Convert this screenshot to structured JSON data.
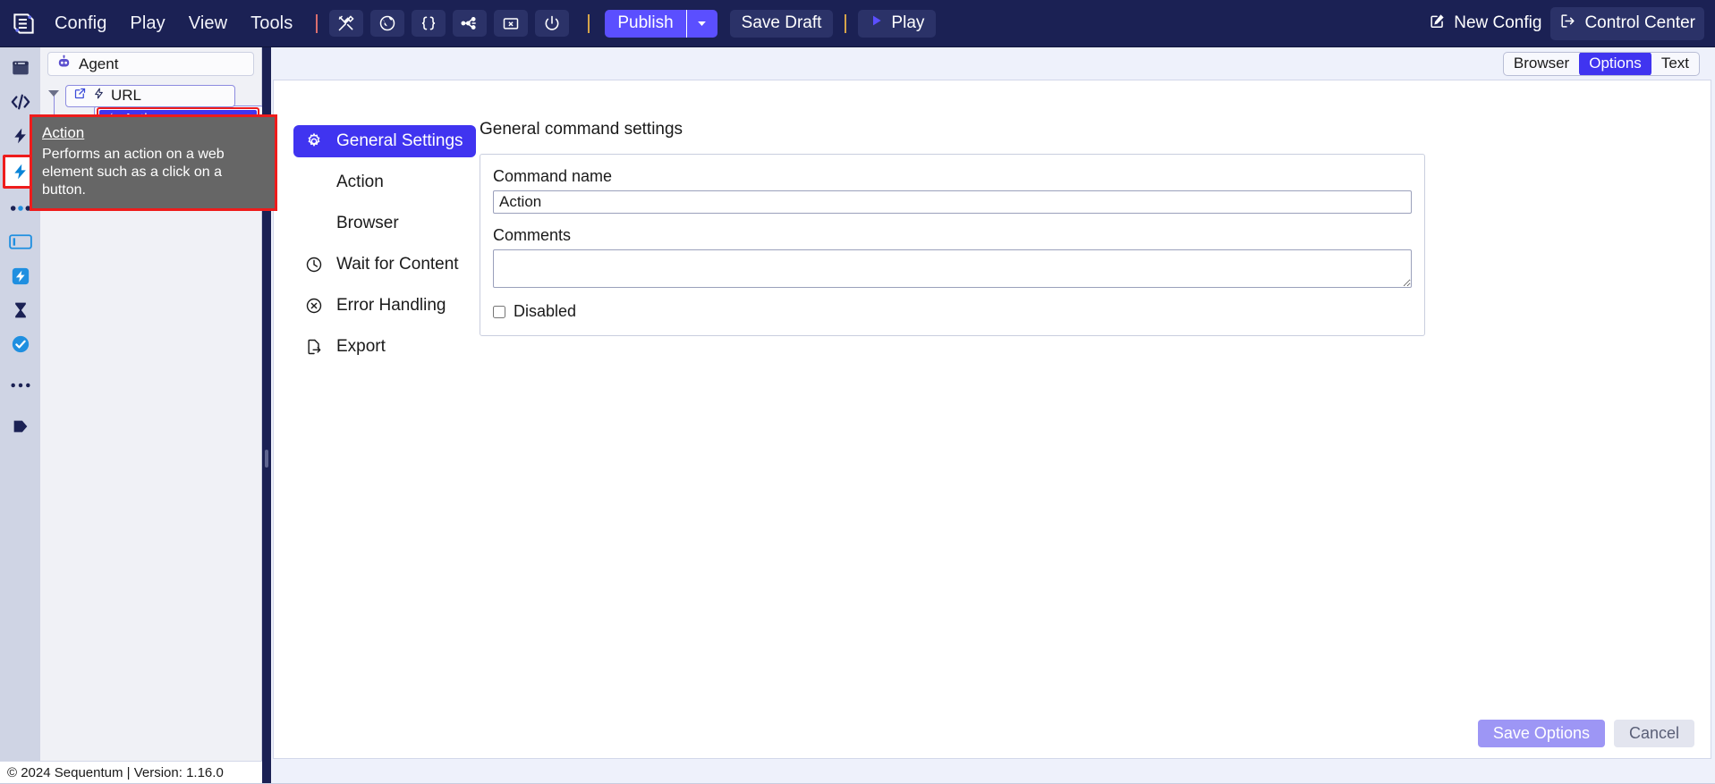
{
  "topbar": {
    "logo": "sequentum-logo-icon",
    "menus": [
      {
        "label": "Config",
        "name": "menu-config"
      },
      {
        "label": "Play",
        "name": "menu-play"
      },
      {
        "label": "View",
        "name": "menu-view"
      },
      {
        "label": "Tools",
        "name": "menu-tools"
      }
    ],
    "tool_icons": [
      {
        "name": "tools-icon",
        "title": "Tools"
      },
      {
        "name": "globe-icon",
        "title": "Browser"
      },
      {
        "name": "code-braces-icon",
        "title": "Script"
      },
      {
        "name": "network-graph-icon",
        "title": "Graph"
      },
      {
        "name": "folder-delete-icon",
        "title": "Clear cache"
      },
      {
        "name": "power-icon",
        "title": "Power"
      }
    ],
    "publish_label": "Publish",
    "publish_caret": "chevron-down-icon",
    "save_draft_label": "Save Draft",
    "play_label": "Play",
    "new_config_label": "New Config",
    "control_center_label": "Control Center",
    "accent_color": "#5b4fff",
    "bar_color": "#1b2154"
  },
  "rail": {
    "items": [
      {
        "name": "rail-browser-icon",
        "selected": false
      },
      {
        "name": "rail-code-icon",
        "selected": false
      },
      {
        "name": "rail-action-dark-icon",
        "selected": false
      },
      {
        "name": "rail-action-blue-icon",
        "selected": true
      },
      {
        "name": "rail-dots-icon",
        "selected": false
      },
      {
        "name": "rail-input-icon",
        "selected": false
      },
      {
        "name": "rail-action-square-icon",
        "selected": false
      },
      {
        "name": "rail-hourglass-icon",
        "selected": false
      },
      {
        "name": "rail-check-circle-icon",
        "selected": false
      },
      {
        "name": "rail-more-icon",
        "selected": false
      },
      {
        "name": "rail-tag-icon",
        "selected": false
      }
    ],
    "background": "#cfd4e4",
    "selection_outline": "#ee1c1c"
  },
  "tree": {
    "agent_label": "Agent",
    "agent_icon": "robot-icon",
    "url_label": "URL",
    "url_icons": [
      "external-link-icon",
      "lightning-icon"
    ],
    "action_label": "Action",
    "action_icon": "lightning-icon",
    "action_selected_color": "#4034f0"
  },
  "tooltip": {
    "title": "Action",
    "description": "Performs an action on a web element such as a click on a button.",
    "background": "#666666",
    "border": "#ee1c1c"
  },
  "view_tabs": {
    "items": [
      {
        "label": "Browser",
        "active": false
      },
      {
        "label": "Options",
        "active": true
      },
      {
        "label": "Text",
        "active": false
      }
    ]
  },
  "settings_nav": {
    "items": [
      {
        "label": "General Settings",
        "icon": "gear-icon",
        "active": true
      },
      {
        "label": "Action",
        "icon": "",
        "active": false
      },
      {
        "label": "Browser",
        "icon": "",
        "active": false
      },
      {
        "label": "Wait for Content",
        "icon": "clock-icon",
        "active": false
      },
      {
        "label": "Error Handling",
        "icon": "error-circle-icon",
        "active": false
      },
      {
        "label": "Export",
        "icon": "export-icon",
        "active": false
      }
    ]
  },
  "panel": {
    "title": "General command settings",
    "command_name_label": "Command name",
    "command_name_value": "Action",
    "command_name_placeholder": "",
    "comments_label": "Comments",
    "comments_value": "",
    "comments_placeholder": "",
    "disabled_label": "Disabled",
    "disabled_checked": false
  },
  "footer": {
    "save_options_label": "Save Options",
    "cancel_label": "Cancel"
  },
  "statusbar": {
    "text": "© 2024 Sequentum | Version: 1.16.0"
  }
}
